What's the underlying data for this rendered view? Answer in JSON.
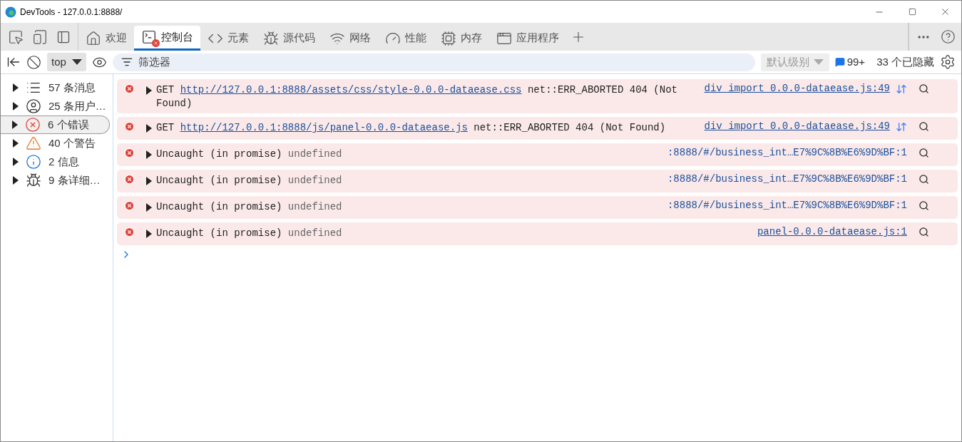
{
  "window": {
    "title": "DevTools - 127.0.0.1:8888/"
  },
  "tabs": [
    {
      "kind": "home",
      "label": "欢迎",
      "selected": false,
      "error_badge": false
    },
    {
      "kind": "console",
      "label": "控制台",
      "selected": true,
      "error_badge": true
    },
    {
      "kind": "elements",
      "label": "元素",
      "selected": false,
      "error_badge": false
    },
    {
      "kind": "sources",
      "label": "源代码",
      "selected": false,
      "error_badge": false
    },
    {
      "kind": "network",
      "label": "网络",
      "selected": false,
      "error_badge": false
    },
    {
      "kind": "performance",
      "label": "性能",
      "selected": false,
      "error_badge": false
    },
    {
      "kind": "memory",
      "label": "内存",
      "selected": false,
      "error_badge": false
    },
    {
      "kind": "application",
      "label": "应用程序",
      "selected": false,
      "error_badge": false
    }
  ],
  "toolbar": {
    "context": "top",
    "filter_placeholder": "筛选器",
    "level": "默认级别",
    "issues": "99+",
    "hidden": "33 个已隐藏"
  },
  "sidebar": {
    "items": [
      {
        "kind": "messages",
        "label": "57 条消息",
        "selected": false
      },
      {
        "kind": "user",
        "label": "25 条用户…",
        "selected": false
      },
      {
        "kind": "errors",
        "label": "6 个错误",
        "selected": true
      },
      {
        "kind": "warnings",
        "label": "40 个警告",
        "selected": false
      },
      {
        "kind": "info",
        "label": "2 信息",
        "selected": false
      },
      {
        "kind": "verbose",
        "label": "9 条详细…",
        "selected": false
      }
    ]
  },
  "messages": [
    {
      "kind": "network",
      "method": "GET",
      "url": "http://127.0.0.1:8888/assets/css/style-0.0.0-dataease.css",
      "text": "net::ERR_ABORTED 404 (Not Found)",
      "source": "div_import_0.0.0-dataease.js:49",
      "source_link": true
    },
    {
      "kind": "network",
      "method": "GET",
      "url": "http://127.0.0.1:8888/js/panel-0.0.0-dataease.js",
      "text": "net::ERR_ABORTED 404 (Not Found)",
      "source": "div_import_0.0.0-dataease.js:49",
      "source_link": true
    },
    {
      "kind": "exception",
      "text": "Uncaught (in promise)",
      "detail": "undefined",
      "source": ":8888/#/business_int…E7%9C%8B%E6%9D%BF:1",
      "source_link": false
    },
    {
      "kind": "exception",
      "text": "Uncaught (in promise)",
      "detail": "undefined",
      "source": ":8888/#/business_int…E7%9C%8B%E6%9D%BF:1",
      "source_link": false
    },
    {
      "kind": "exception",
      "text": "Uncaught (in promise)",
      "detail": "undefined",
      "source": ":8888/#/business_int…E7%9C%8B%E6%9D%BF:1",
      "source_link": false
    },
    {
      "kind": "exception",
      "text": "Uncaught (in promise)",
      "detail": "undefined",
      "source": "panel-0.0.0-dataease.js:1",
      "source_link": true
    }
  ]
}
